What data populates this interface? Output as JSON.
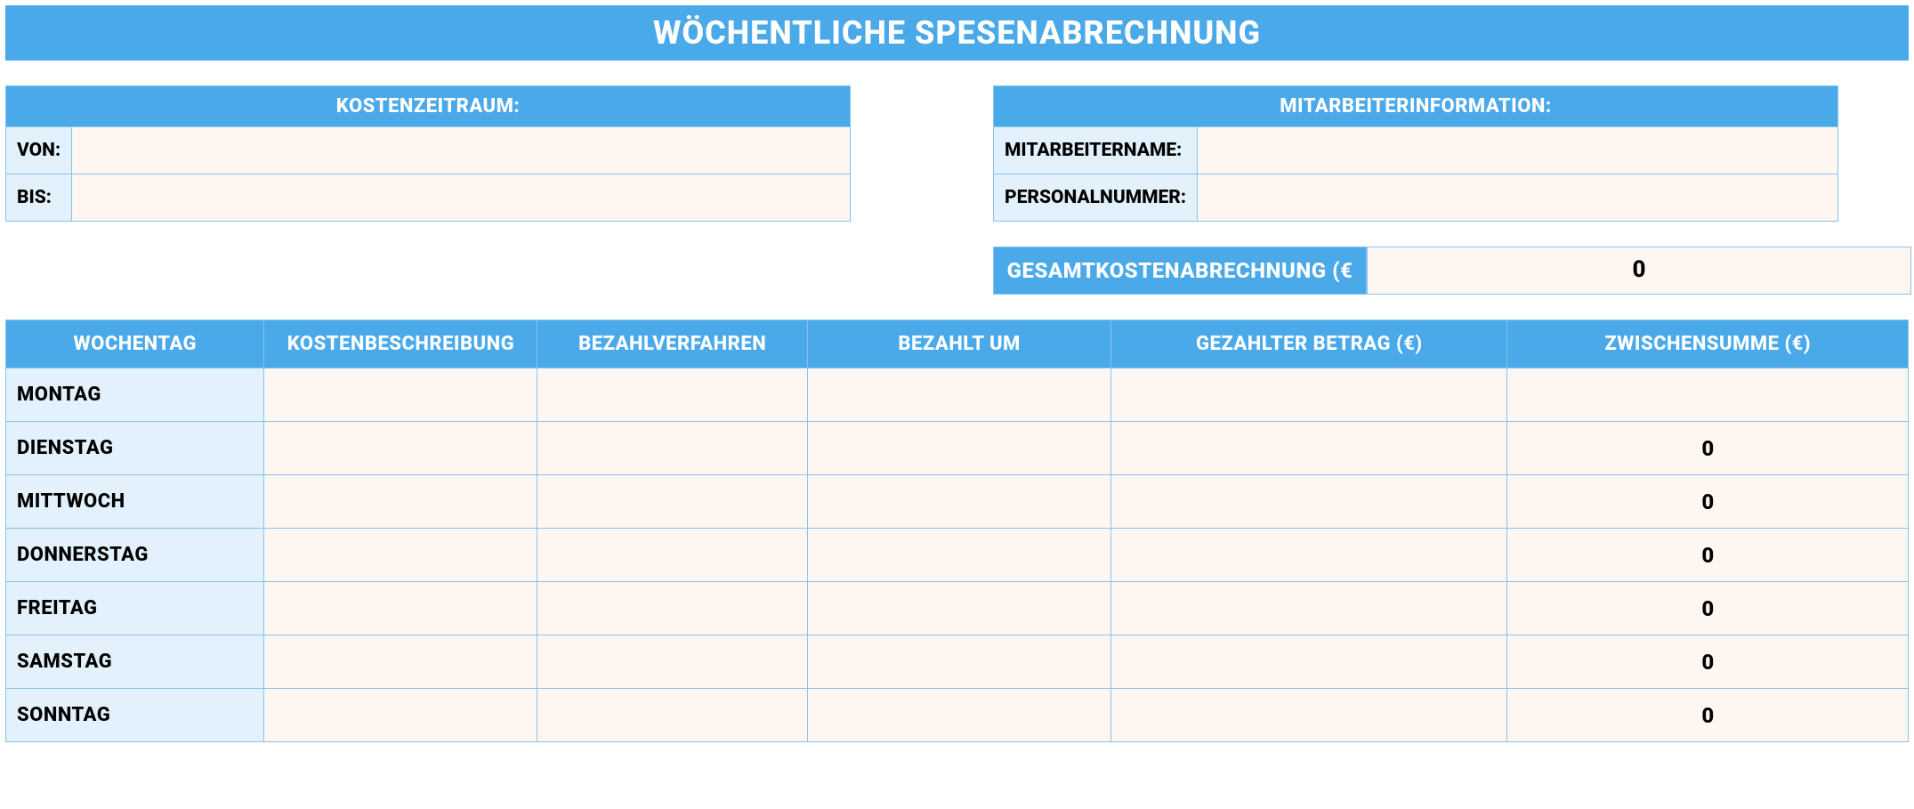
{
  "title": "WÖCHENTLICHE SPESENABRECHNUNG",
  "period": {
    "header": "KOSTENZEITRAUM:",
    "from_label": "VON:",
    "to_label": "BIS:",
    "from_value": "",
    "to_value": ""
  },
  "employee": {
    "header": "MITARBEITERINFORMATION:",
    "name_label": "MITARBEITERNAME:",
    "id_label": "PERSONALNUMMER:",
    "name_value": "",
    "id_value": ""
  },
  "total": {
    "label": "GESAMTKOSTENABRECHNUNG (€",
    "value": "0"
  },
  "columns": {
    "day": "WOCHENTAG",
    "desc": "KOSTENBESCHREIBUNG",
    "method": "BEZAHLVERFAHREN",
    "paid_at": "BEZAHLT UM",
    "amount": "GEZAHLTER BETRAG (€)",
    "subtotal": "ZWISCHENSUMME (€)"
  },
  "rows": [
    {
      "day": "MONTAG",
      "desc": "",
      "method": "",
      "paid_at": "",
      "amount": "",
      "subtotal": ""
    },
    {
      "day": "DIENSTAG",
      "desc": "",
      "method": "",
      "paid_at": "",
      "amount": "",
      "subtotal": "0"
    },
    {
      "day": "MITTWOCH",
      "desc": "",
      "method": "",
      "paid_at": "",
      "amount": "",
      "subtotal": "0"
    },
    {
      "day": "DONNERSTAG",
      "desc": "",
      "method": "",
      "paid_at": "",
      "amount": "",
      "subtotal": "0"
    },
    {
      "day": "FREITAG",
      "desc": "",
      "method": "",
      "paid_at": "",
      "amount": "",
      "subtotal": "0"
    },
    {
      "day": "SAMSTAG",
      "desc": "",
      "method": "",
      "paid_at": "",
      "amount": "",
      "subtotal": "0"
    },
    {
      "day": "SONNTAG",
      "desc": "",
      "method": "",
      "paid_at": "",
      "amount": "",
      "subtotal": "0"
    }
  ]
}
